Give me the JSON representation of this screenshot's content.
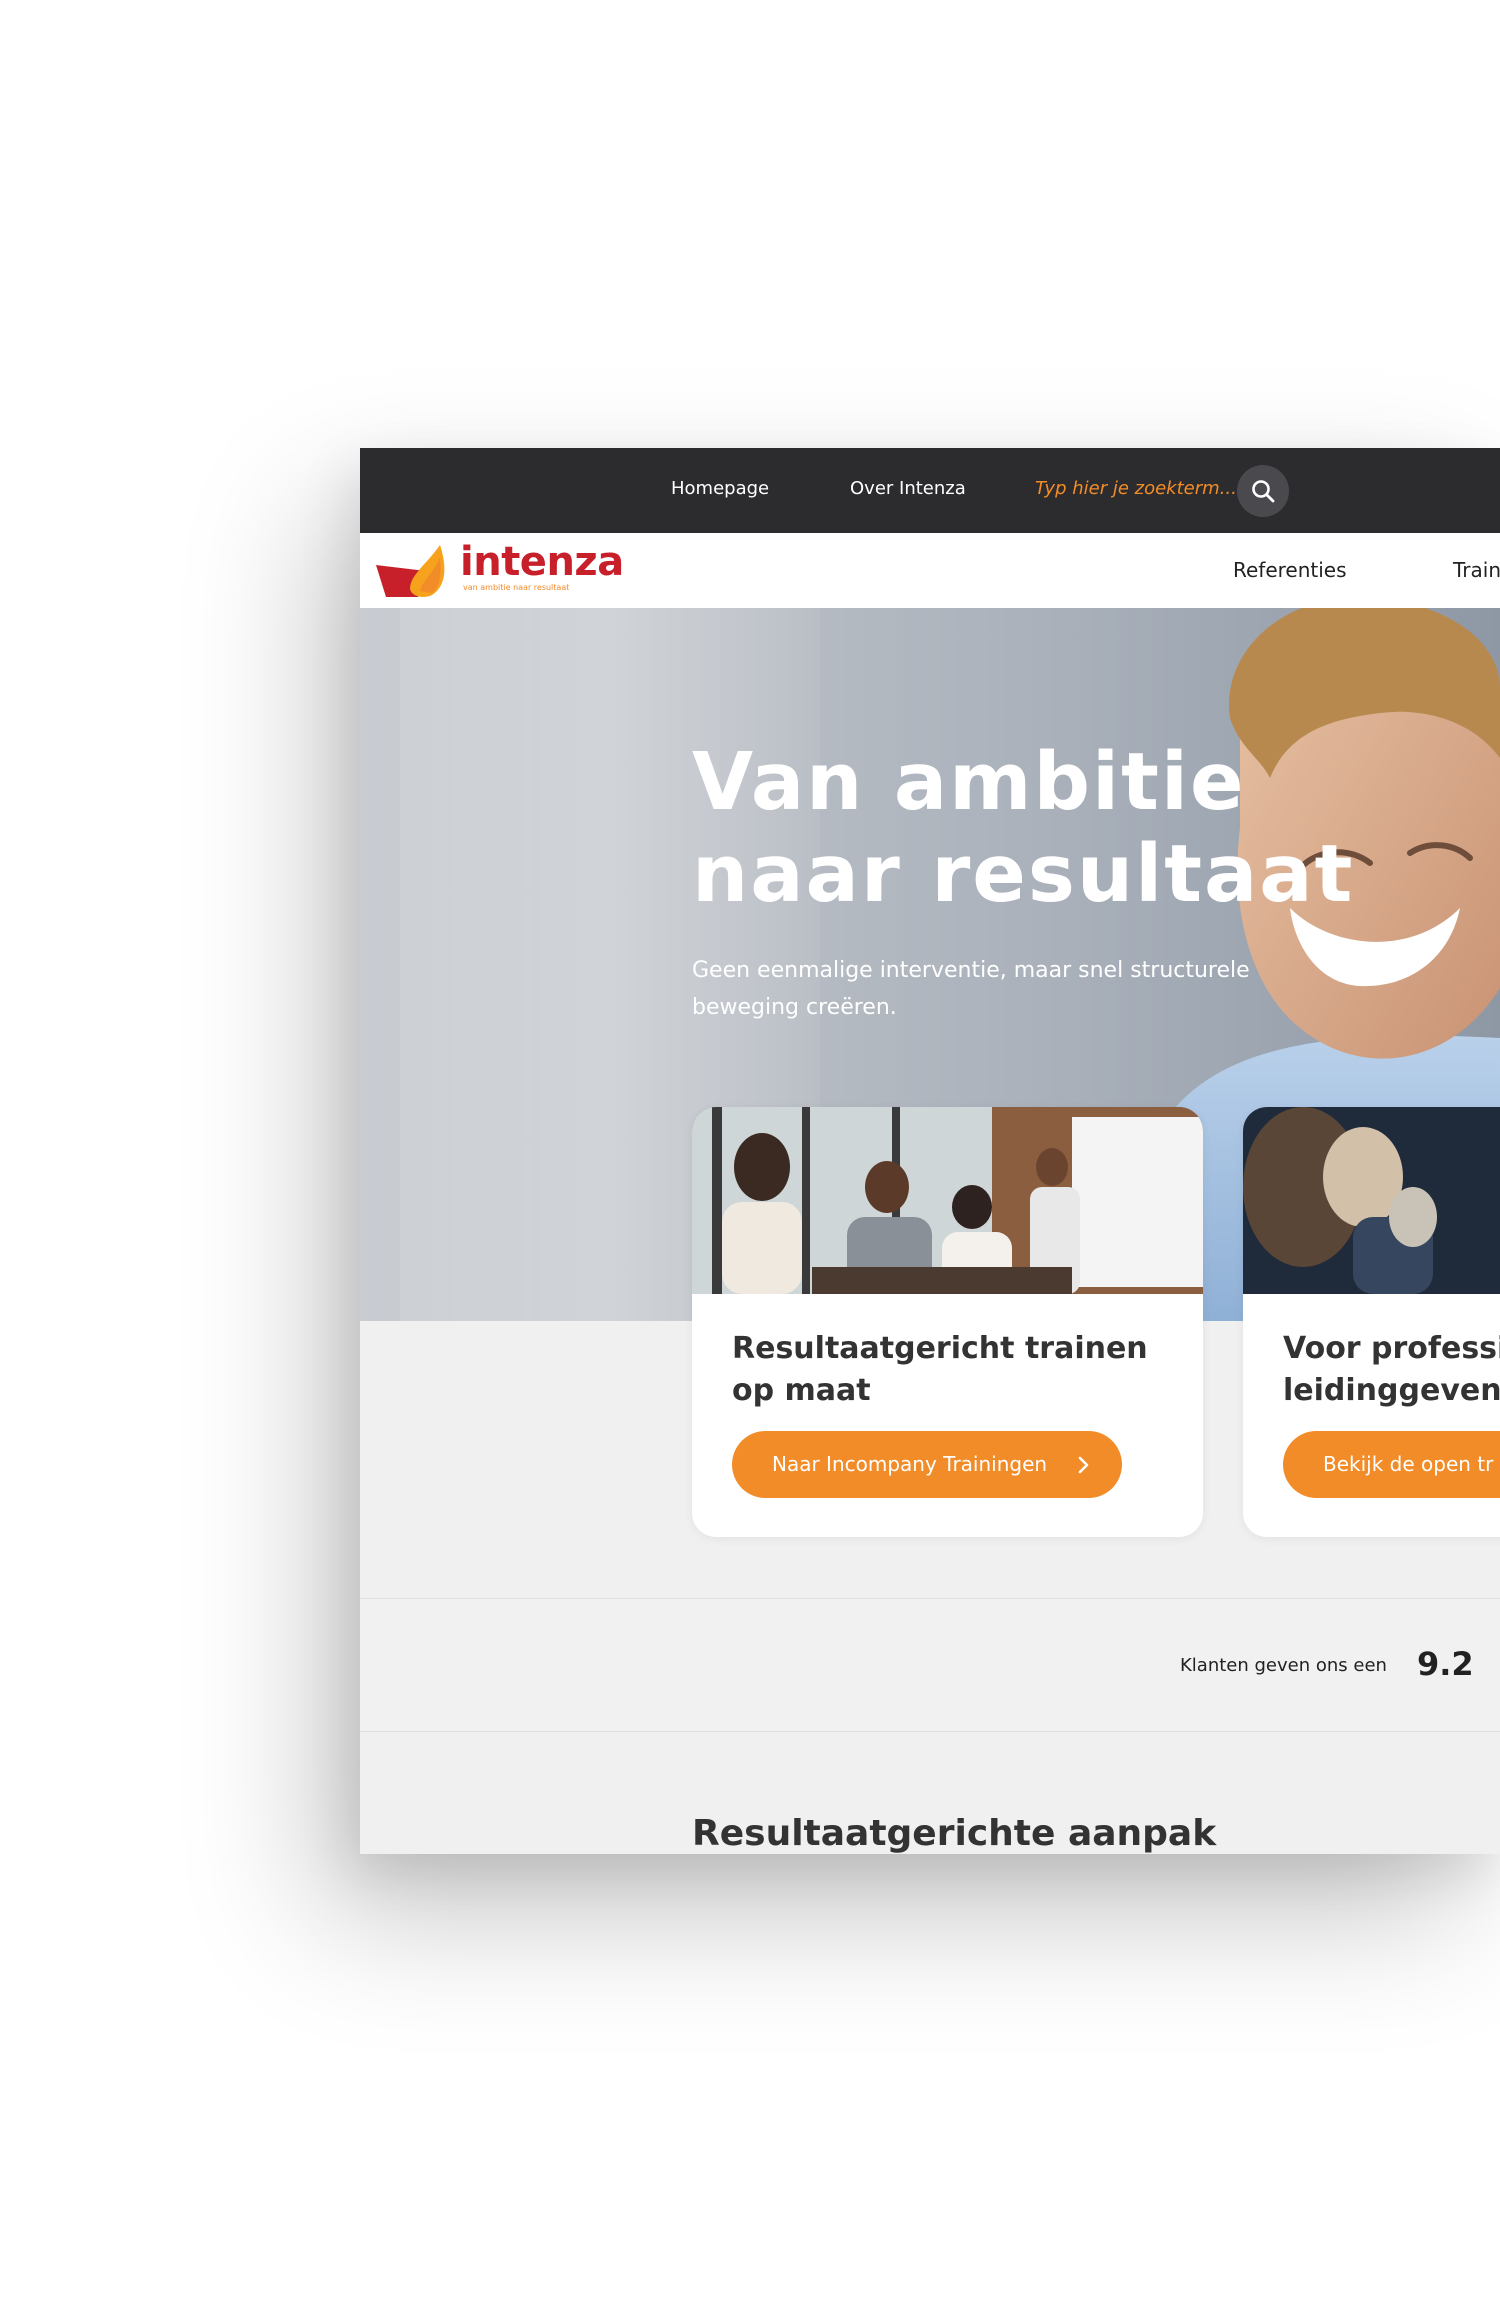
{
  "topbar": {
    "nav": [
      "Homepage",
      "Over Intenza"
    ],
    "search_placeholder": "Typ hier je zoekterm..."
  },
  "header": {
    "logo_text": "intenza",
    "logo_tagline": "van ambitie naar resultaat",
    "menu": [
      "Referenties",
      "Train"
    ]
  },
  "hero": {
    "title_line1": "Van ambitie",
    "title_line2": "naar resultaat",
    "subtitle": "Geen eenmalige interventie, maar snel structurele beweging creëren."
  },
  "cards": [
    {
      "title": "Resultaatgericht trainen op maat",
      "button": "Naar Incompany Trainingen"
    },
    {
      "title": "Voor professio leidinggevende",
      "button": "Bekijk de open tr"
    }
  ],
  "rating": {
    "text": "Klanten geven ons een",
    "score": "9.2"
  },
  "section": {
    "title": "Resultaatgerichte aanpak"
  },
  "colors": {
    "accent": "#f28c28",
    "brand_red": "#c8202a",
    "topbar": "#2c2c2f"
  }
}
